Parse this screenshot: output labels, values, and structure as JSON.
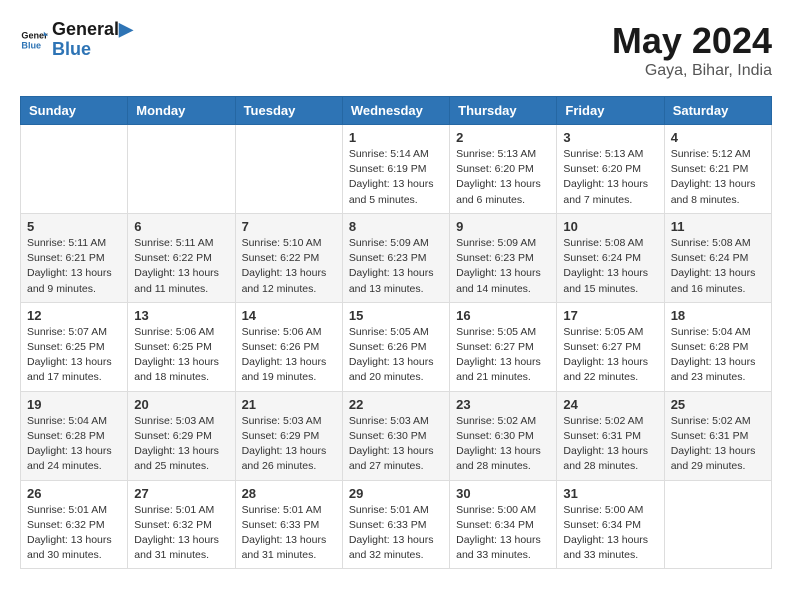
{
  "header": {
    "logo_line1": "General",
    "logo_line2": "Blue",
    "main_title": "May 2024",
    "sub_title": "Gaya, Bihar, India"
  },
  "weekdays": [
    "Sunday",
    "Monday",
    "Tuesday",
    "Wednesday",
    "Thursday",
    "Friday",
    "Saturday"
  ],
  "weeks": [
    [
      {
        "day": "",
        "info": ""
      },
      {
        "day": "",
        "info": ""
      },
      {
        "day": "",
        "info": ""
      },
      {
        "day": "1",
        "info": "Sunrise: 5:14 AM\nSunset: 6:19 PM\nDaylight: 13 hours\nand 5 minutes."
      },
      {
        "day": "2",
        "info": "Sunrise: 5:13 AM\nSunset: 6:20 PM\nDaylight: 13 hours\nand 6 minutes."
      },
      {
        "day": "3",
        "info": "Sunrise: 5:13 AM\nSunset: 6:20 PM\nDaylight: 13 hours\nand 7 minutes."
      },
      {
        "day": "4",
        "info": "Sunrise: 5:12 AM\nSunset: 6:21 PM\nDaylight: 13 hours\nand 8 minutes."
      }
    ],
    [
      {
        "day": "5",
        "info": "Sunrise: 5:11 AM\nSunset: 6:21 PM\nDaylight: 13 hours\nand 9 minutes."
      },
      {
        "day": "6",
        "info": "Sunrise: 5:11 AM\nSunset: 6:22 PM\nDaylight: 13 hours\nand 11 minutes."
      },
      {
        "day": "7",
        "info": "Sunrise: 5:10 AM\nSunset: 6:22 PM\nDaylight: 13 hours\nand 12 minutes."
      },
      {
        "day": "8",
        "info": "Sunrise: 5:09 AM\nSunset: 6:23 PM\nDaylight: 13 hours\nand 13 minutes."
      },
      {
        "day": "9",
        "info": "Sunrise: 5:09 AM\nSunset: 6:23 PM\nDaylight: 13 hours\nand 14 minutes."
      },
      {
        "day": "10",
        "info": "Sunrise: 5:08 AM\nSunset: 6:24 PM\nDaylight: 13 hours\nand 15 minutes."
      },
      {
        "day": "11",
        "info": "Sunrise: 5:08 AM\nSunset: 6:24 PM\nDaylight: 13 hours\nand 16 minutes."
      }
    ],
    [
      {
        "day": "12",
        "info": "Sunrise: 5:07 AM\nSunset: 6:25 PM\nDaylight: 13 hours\nand 17 minutes."
      },
      {
        "day": "13",
        "info": "Sunrise: 5:06 AM\nSunset: 6:25 PM\nDaylight: 13 hours\nand 18 minutes."
      },
      {
        "day": "14",
        "info": "Sunrise: 5:06 AM\nSunset: 6:26 PM\nDaylight: 13 hours\nand 19 minutes."
      },
      {
        "day": "15",
        "info": "Sunrise: 5:05 AM\nSunset: 6:26 PM\nDaylight: 13 hours\nand 20 minutes."
      },
      {
        "day": "16",
        "info": "Sunrise: 5:05 AM\nSunset: 6:27 PM\nDaylight: 13 hours\nand 21 minutes."
      },
      {
        "day": "17",
        "info": "Sunrise: 5:05 AM\nSunset: 6:27 PM\nDaylight: 13 hours\nand 22 minutes."
      },
      {
        "day": "18",
        "info": "Sunrise: 5:04 AM\nSunset: 6:28 PM\nDaylight: 13 hours\nand 23 minutes."
      }
    ],
    [
      {
        "day": "19",
        "info": "Sunrise: 5:04 AM\nSunset: 6:28 PM\nDaylight: 13 hours\nand 24 minutes."
      },
      {
        "day": "20",
        "info": "Sunrise: 5:03 AM\nSunset: 6:29 PM\nDaylight: 13 hours\nand 25 minutes."
      },
      {
        "day": "21",
        "info": "Sunrise: 5:03 AM\nSunset: 6:29 PM\nDaylight: 13 hours\nand 26 minutes."
      },
      {
        "day": "22",
        "info": "Sunrise: 5:03 AM\nSunset: 6:30 PM\nDaylight: 13 hours\nand 27 minutes."
      },
      {
        "day": "23",
        "info": "Sunrise: 5:02 AM\nSunset: 6:30 PM\nDaylight: 13 hours\nand 28 minutes."
      },
      {
        "day": "24",
        "info": "Sunrise: 5:02 AM\nSunset: 6:31 PM\nDaylight: 13 hours\nand 28 minutes."
      },
      {
        "day": "25",
        "info": "Sunrise: 5:02 AM\nSunset: 6:31 PM\nDaylight: 13 hours\nand 29 minutes."
      }
    ],
    [
      {
        "day": "26",
        "info": "Sunrise: 5:01 AM\nSunset: 6:32 PM\nDaylight: 13 hours\nand 30 minutes."
      },
      {
        "day": "27",
        "info": "Sunrise: 5:01 AM\nSunset: 6:32 PM\nDaylight: 13 hours\nand 31 minutes."
      },
      {
        "day": "28",
        "info": "Sunrise: 5:01 AM\nSunset: 6:33 PM\nDaylight: 13 hours\nand 31 minutes."
      },
      {
        "day": "29",
        "info": "Sunrise: 5:01 AM\nSunset: 6:33 PM\nDaylight: 13 hours\nand 32 minutes."
      },
      {
        "day": "30",
        "info": "Sunrise: 5:00 AM\nSunset: 6:34 PM\nDaylight: 13 hours\nand 33 minutes."
      },
      {
        "day": "31",
        "info": "Sunrise: 5:00 AM\nSunset: 6:34 PM\nDaylight: 13 hours\nand 33 minutes."
      },
      {
        "day": "",
        "info": ""
      }
    ]
  ]
}
